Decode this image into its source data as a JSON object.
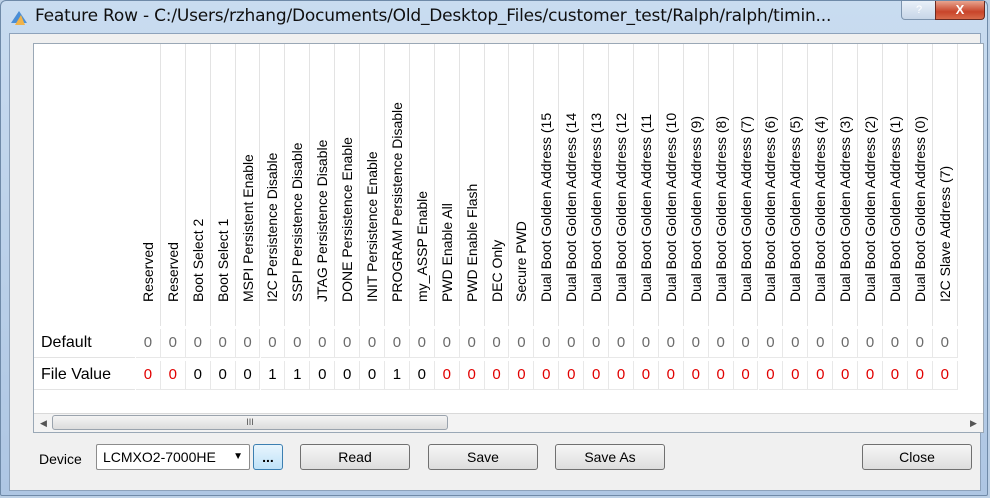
{
  "window": {
    "title": "Feature Row - C:/Users/rzhang/Documents/Old_Desktop_Files/customer_test/Ralph/ralph/timin...",
    "help_label": "?",
    "close_label": "X"
  },
  "table": {
    "columns": [
      "Reserved",
      "Reserved",
      "Boot Select 2",
      "Boot Select 1",
      "MSPI Persistent Enable",
      "I2C Persistence Disable",
      "SSPI Persistence Disable",
      "JTAG Persistence Disable",
      "DONE Persistence Enable",
      "INIT Persistence Enable",
      "PROGRAM Persistence Disable",
      "my_ASSP Enable",
      "PWD Enable All",
      "PWD Enable Flash",
      "DEC Only",
      "Secure PWD",
      "Dual Boot Golden Address (15",
      "Dual Boot Golden Address (14",
      "Dual Boot Golden Address (13",
      "Dual Boot Golden Address (12",
      "Dual Boot Golden Address (11",
      "Dual Boot Golden Address (10",
      "Dual Boot Golden Address (9)",
      "Dual Boot Golden Address (8)",
      "Dual Boot Golden Address (7)",
      "Dual Boot Golden Address (6)",
      "Dual Boot Golden Address (5)",
      "Dual Boot Golden Address (4)",
      "Dual Boot Golden Address (3)",
      "Dual Boot Golden Address (2)",
      "Dual Boot Golden Address (1)",
      "Dual Boot Golden Address (0)",
      "I2C Slave Address (7)"
    ],
    "rows": [
      {
        "label": "Default",
        "values": [
          "0",
          "0",
          "0",
          "0",
          "0",
          "0",
          "0",
          "0",
          "0",
          "0",
          "0",
          "0",
          "0",
          "0",
          "0",
          "0",
          "0",
          "0",
          "0",
          "0",
          "0",
          "0",
          "0",
          "0",
          "0",
          "0",
          "0",
          "0",
          "0",
          "0",
          "0",
          "0",
          "0"
        ]
      },
      {
        "label": "File Value",
        "values": [
          "0",
          "0",
          "0",
          "0",
          "0",
          "1",
          "1",
          "0",
          "0",
          "0",
          "1",
          "0",
          "0",
          "0",
          "0",
          "0",
          "0",
          "0",
          "0",
          "0",
          "0",
          "0",
          "0",
          "0",
          "0",
          "0",
          "0",
          "0",
          "0",
          "0",
          "0",
          "0",
          "0"
        ],
        "highlight": [
          true,
          true,
          false,
          false,
          false,
          false,
          false,
          false,
          false,
          false,
          false,
          false,
          true,
          true,
          true,
          true,
          true,
          true,
          true,
          true,
          true,
          true,
          true,
          true,
          true,
          true,
          true,
          true,
          true,
          true,
          true,
          true,
          true
        ]
      }
    ],
    "scroll_thumb_grip": "III",
    "scroll_left": "◀",
    "scroll_right": "▶"
  },
  "footer": {
    "device_label": "Device",
    "device_value": "LCMXO2-7000HE",
    "dots_label": "...",
    "read_label": "Read",
    "save_label": "Save",
    "save_as_label": "Save As",
    "close_label": "Close"
  },
  "colors": {
    "highlight_value": "#e10000",
    "default_value": "#6b6b6b",
    "close_button": "#c8442a"
  }
}
